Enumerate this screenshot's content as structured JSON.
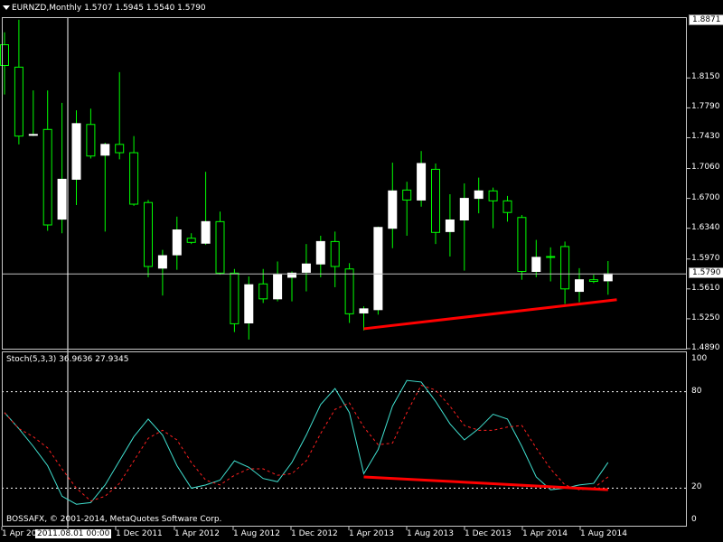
{
  "chart": {
    "header_text": "EURNZD,Monthly  1.5707 1.5945 1.5540 1.5790",
    "price_ticks": [
      "1.8150",
      "1.7790",
      "1.7430",
      "1.7060",
      "1.6700",
      "1.6340",
      "1.5970",
      "1.5610",
      "1.5250",
      "1.4890"
    ],
    "top_price_label": "1.8871",
    "current_price_label": "1.5790",
    "colors": {
      "background": "#000000",
      "grid_border": "#c8c8c8",
      "bull_body": "#ffffff",
      "bear_body": "#000000",
      "wick": "#00ff00",
      "trendline": "#ff0000",
      "stoch_main": "#40e0d0",
      "stoch_signal": "#ff2020",
      "level_lines": "#ffffff"
    }
  },
  "indicator": {
    "header_text": "Stoch(5,3,3) 36.9636 27.9345",
    "ticks": [
      "100",
      "80",
      "20",
      "0"
    ]
  },
  "time_axis": {
    "labels": [
      "1 Apr 20",
      "1 Dec 2011",
      "1 Apr 2012",
      "1 Aug 2012",
      "1 Dec 2012",
      "1 Apr 2013",
      "1 Aug 2013",
      "1 Dec 2013",
      "1 Apr 2014",
      "1 Aug 2014"
    ],
    "cursor_label": "2011.08.01 00:00"
  },
  "copyright": "BOSSAFX, © 2001-2014, MetaQuotes Software Corp.",
  "chart_data": [
    {
      "type": "candlestick",
      "title": "EURNZD,Monthly",
      "ylim": [
        1.489,
        1.8871
      ],
      "candles": [
        {
          "o": 1.855,
          "h": 1.87,
          "l": 1.795,
          "c": 1.83
        },
        {
          "o": 1.828,
          "h": 1.885,
          "l": 1.735,
          "c": 1.745
        },
        {
          "o": 1.747,
          "h": 1.8,
          "l": 1.745,
          "c": 1.747
        },
        {
          "o": 1.753,
          "h": 1.8,
          "l": 1.631,
          "c": 1.638
        },
        {
          "o": 1.645,
          "h": 1.785,
          "l": 1.628,
          "c": 1.693
        },
        {
          "o": 1.693,
          "h": 1.776,
          "l": 1.662,
          "c": 1.76
        },
        {
          "o": 1.759,
          "h": 1.778,
          "l": 1.718,
          "c": 1.721
        },
        {
          "o": 1.722,
          "h": 1.737,
          "l": 1.63,
          "c": 1.735
        },
        {
          "o": 1.735,
          "h": 1.822,
          "l": 1.717,
          "c": 1.725
        },
        {
          "o": 1.725,
          "h": 1.745,
          "l": 1.661,
          "c": 1.663
        },
        {
          "o": 1.665,
          "h": 1.668,
          "l": 1.575,
          "c": 1.588
        },
        {
          "o": 1.586,
          "h": 1.608,
          "l": 1.553,
          "c": 1.601
        },
        {
          "o": 1.602,
          "h": 1.648,
          "l": 1.584,
          "c": 1.632
        },
        {
          "o": 1.622,
          "h": 1.628,
          "l": 1.615,
          "c": 1.617
        },
        {
          "o": 1.616,
          "h": 1.702,
          "l": 1.614,
          "c": 1.642
        },
        {
          "o": 1.642,
          "h": 1.654,
          "l": 1.578,
          "c": 1.58
        },
        {
          "o": 1.58,
          "h": 1.585,
          "l": 1.509,
          "c": 1.519
        },
        {
          "o": 1.52,
          "h": 1.576,
          "l": 1.5,
          "c": 1.566
        },
        {
          "o": 1.567,
          "h": 1.585,
          "l": 1.544,
          "c": 1.549
        },
        {
          "o": 1.549,
          "h": 1.594,
          "l": 1.546,
          "c": 1.578
        },
        {
          "o": 1.575,
          "h": 1.582,
          "l": 1.546,
          "c": 1.58
        },
        {
          "o": 1.581,
          "h": 1.615,
          "l": 1.558,
          "c": 1.591
        },
        {
          "o": 1.591,
          "h": 1.625,
          "l": 1.575,
          "c": 1.618
        },
        {
          "o": 1.618,
          "h": 1.63,
          "l": 1.563,
          "c": 1.588
        },
        {
          "o": 1.585,
          "h": 1.592,
          "l": 1.52,
          "c": 1.531
        },
        {
          "o": 1.532,
          "h": 1.54,
          "l": 1.511,
          "c": 1.537
        },
        {
          "o": 1.536,
          "h": 1.636,
          "l": 1.53,
          "c": 1.635
        },
        {
          "o": 1.634,
          "h": 1.713,
          "l": 1.61,
          "c": 1.679
        },
        {
          "o": 1.68,
          "h": 1.69,
          "l": 1.625,
          "c": 1.668
        },
        {
          "o": 1.668,
          "h": 1.727,
          "l": 1.66,
          "c": 1.712
        },
        {
          "o": 1.705,
          "h": 1.712,
          "l": 1.615,
          "c": 1.629
        },
        {
          "o": 1.63,
          "h": 1.675,
          "l": 1.6,
          "c": 1.644
        },
        {
          "o": 1.644,
          "h": 1.688,
          "l": 1.583,
          "c": 1.67
        },
        {
          "o": 1.67,
          "h": 1.695,
          "l": 1.652,
          "c": 1.679
        },
        {
          "o": 1.679,
          "h": 1.683,
          "l": 1.634,
          "c": 1.667
        },
        {
          "o": 1.667,
          "h": 1.673,
          "l": 1.642,
          "c": 1.653
        },
        {
          "o": 1.647,
          "h": 1.65,
          "l": 1.572,
          "c": 1.582
        },
        {
          "o": 1.582,
          "h": 1.62,
          "l": 1.575,
          "c": 1.599
        },
        {
          "o": 1.6,
          "h": 1.611,
          "l": 1.57,
          "c": 1.599
        },
        {
          "o": 1.612,
          "h": 1.618,
          "l": 1.543,
          "c": 1.561
        },
        {
          "o": 1.558,
          "h": 1.586,
          "l": 1.545,
          "c": 1.572
        },
        {
          "o": 1.572,
          "h": 1.578,
          "l": 1.568,
          "c": 1.57
        },
        {
          "o": 1.5707,
          "h": 1.5945,
          "l": 1.554,
          "c": 1.579
        }
      ],
      "trendline": {
        "from": [
          25,
          1.513
        ],
        "to": [
          45,
          1.548
        ]
      },
      "current_price": 1.579
    },
    {
      "type": "line",
      "title": "Stoch(5,3,3)",
      "ylim": [
        0,
        100
      ],
      "levels": [
        80,
        20
      ],
      "series": [
        {
          "name": "main",
          "values": [
            67,
            57,
            46,
            34,
            15,
            10,
            11,
            22,
            37,
            52,
            63,
            53,
            34,
            20,
            22,
            25,
            37,
            33,
            26,
            24,
            36,
            53,
            72,
            82,
            67,
            29,
            44,
            71,
            87,
            86,
            74,
            60,
            50,
            57,
            66,
            63,
            46,
            27,
            19,
            20,
            22,
            23,
            36
          ]
        },
        {
          "name": "signal",
          "values": [
            67,
            57,
            52,
            45,
            32,
            20,
            12,
            15,
            23,
            37,
            51,
            56,
            50,
            36,
            25,
            22,
            28,
            32,
            32,
            28,
            29,
            37,
            54,
            69,
            73,
            58,
            47,
            48,
            67,
            84,
            81,
            71,
            59,
            56,
            56,
            58,
            59,
            45,
            32,
            22,
            19,
            20,
            27
          ]
        }
      ],
      "trendline": {
        "from": [
          25,
          27
        ],
        "to": [
          42,
          19
        ]
      }
    }
  ]
}
